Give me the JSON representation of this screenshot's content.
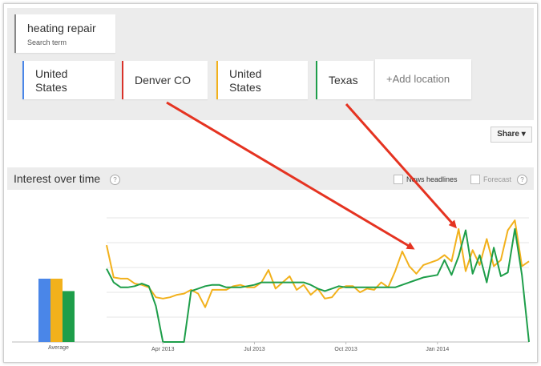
{
  "search_term": {
    "text": "heating repair",
    "sublabel": "Search term"
  },
  "locations": [
    {
      "line1": "United",
      "line2": "States",
      "color": "#4a86e8"
    },
    {
      "line1": "Denver CO",
      "line2": "",
      "color": "#d9322a"
    },
    {
      "line1": "United",
      "line2": "States",
      "color": "#f2b11c"
    },
    {
      "line1": "Texas",
      "line2": "",
      "color": "#1e9e4a"
    }
  ],
  "add_location_label": "+Add location",
  "share_label": "Share ▾",
  "interest_section": {
    "title": "Interest over time",
    "help_glyph": "?",
    "news_label": "News headlines",
    "forecast_label": "Forecast"
  },
  "chart_data": {
    "type": "line",
    "title": "",
    "x_tick_labels": [
      "Apr 2013",
      "Jul 2013",
      "Oct 2013",
      "Jan 2014"
    ],
    "x_ticks": [
      8,
      21,
      34,
      47
    ],
    "ylim": [
      0,
      100
    ],
    "gridlines": [
      0,
      20,
      40,
      60,
      80,
      100
    ],
    "grid": true,
    "series": [
      {
        "color": "#f2b11c",
        "values": [
          78,
          52,
          51,
          51,
          47,
          46,
          44,
          36,
          35,
          36,
          38,
          39,
          42,
          39,
          28,
          42,
          42,
          42,
          45,
          46,
          44,
          44,
          48,
          58,
          43,
          48,
          53,
          42,
          46,
          38,
          43,
          35,
          36,
          43,
          45,
          45,
          40,
          43,
          42,
          48,
          44,
          57,
          73,
          61,
          55,
          62,
          64,
          66,
          70,
          65,
          91,
          57,
          74,
          62,
          83,
          61,
          66,
          90,
          98,
          61,
          65
        ]
      },
      {
        "color": "#1e9e4a",
        "values": [
          59,
          48,
          44,
          44,
          45,
          47,
          45,
          29,
          0,
          0,
          0,
          0,
          41,
          43,
          45,
          46,
          46,
          44,
          44,
          44,
          45,
          46,
          48,
          48,
          48,
          48,
          48,
          48,
          48,
          46,
          43,
          41,
          43,
          45,
          44,
          44,
          44,
          44,
          44,
          44,
          44,
          44,
          46,
          48,
          50,
          52,
          53,
          54,
          66,
          54,
          69,
          90,
          55,
          70,
          48,
          76,
          53,
          56,
          91,
          54,
          0
        ]
      },
      {
        "name": "Average",
        "type": "bar",
        "colors": [
          "#4a86e8",
          "#f2b11c",
          "#1e9e4a"
        ],
        "values": [
          51,
          51,
          41
        ]
      }
    ],
    "average_label": "Average"
  }
}
